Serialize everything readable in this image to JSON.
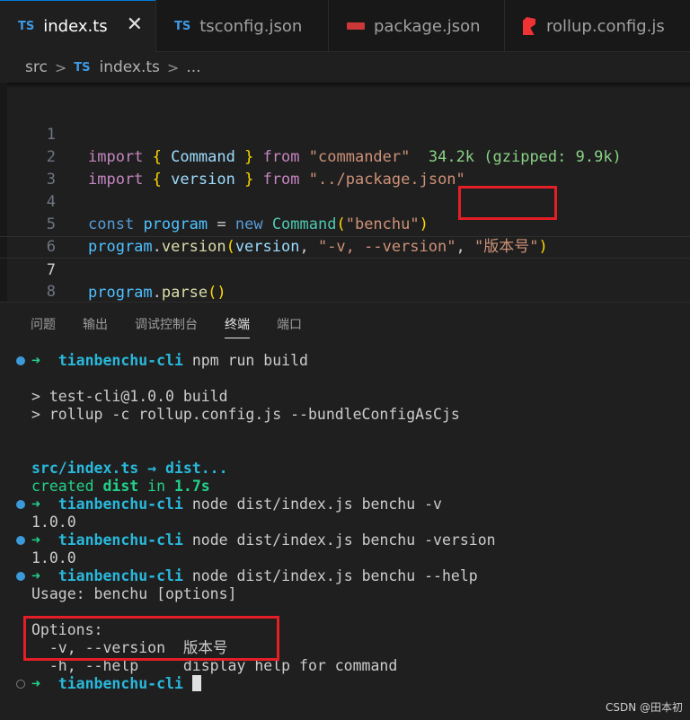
{
  "tabs": [
    {
      "icon": "TS",
      "label": "index.ts",
      "close": "✕"
    },
    {
      "icon": "{}",
      "label": "tsconfig.json"
    },
    {
      "label": "package.json"
    },
    {
      "label": "rollup.config.js"
    }
  ],
  "breadcrumb": {
    "folder": "src",
    "file_icon": "TS",
    "file": "index.ts",
    "more": "..."
  },
  "editor": {
    "lines": [
      {
        "n": "1",
        "t": {
          "a": "import",
          "b": "{",
          "c": "Command",
          "d": "}",
          "e": "from",
          "f": "\"commander\"",
          "g": "34.2k (gzipped: 9.9k)"
        }
      },
      {
        "n": "2",
        "t": {
          "a": "import",
          "b": "{",
          "c": "version",
          "d": "}",
          "e": "from",
          "f": "\"../package.json\""
        }
      },
      {
        "n": "3"
      },
      {
        "n": "4",
        "t": {
          "a": "const",
          "b": "program",
          "c": "=",
          "d": "new",
          "e": "Command",
          "f": "(",
          "g": "\"benchu\"",
          "h": ")"
        }
      },
      {
        "n": "5",
        "t": {
          "a": "program",
          "b": ".",
          "c": "version",
          "d": "(",
          "e": "version",
          "f": ", ",
          "g": "\"-v, --version\"",
          "h": ", ",
          "i": "\"版本号\"",
          "j": ")"
        }
      },
      {
        "n": "6"
      },
      {
        "n": "7",
        "t": {
          "a": "program",
          "b": ".",
          "c": "parse",
          "d": "()"
        }
      },
      {
        "n": "8"
      }
    ]
  },
  "panel": {
    "tabs": [
      "问题",
      "输出",
      "调试控制台",
      "终端",
      "端口"
    ],
    "active_tab": "终端"
  },
  "terminal": {
    "prompt_arrow": "➜",
    "dir": "tianbenchu-cli",
    "cmd1": "npm run build",
    "out1": "> test-cli@1.0.0 build",
    "out2": "> rollup -c rollup.config.js --bundleConfigAsCjs",
    "bundle_line": "src/index.ts → dist...",
    "created_a": "created",
    "created_b": "dist",
    "created_c": "in",
    "created_d": "1.7s",
    "cmd2": "node dist/index.js benchu -v",
    "res2": "1.0.0",
    "cmd3": "node dist/index.js benchu -version",
    "res3": "1.0.0",
    "cmd4": "node dist/index.js benchu --help",
    "usage": "Usage: benchu [options]",
    "options_title": "Options:",
    "opt_v": "  -v, --version  版本号",
    "opt_h": "  -h, --help     display help for command"
  },
  "colors": {
    "accent": "#0078d4",
    "highlight_box": "#e41e26",
    "terminal_green": "#23d18b",
    "terminal_cyan": "#29b8db"
  },
  "watermark": "CSDN @田本初"
}
